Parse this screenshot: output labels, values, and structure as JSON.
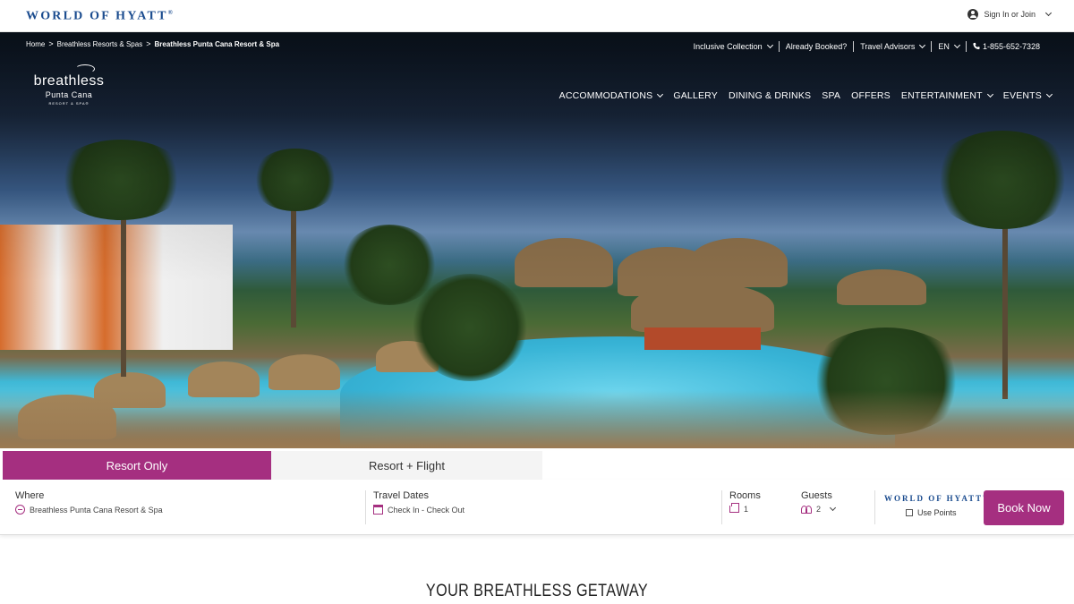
{
  "topbar": {
    "logo_text": "WORLD OF HYATT",
    "logo_mark": "®",
    "signin_label": "Sign In or Join"
  },
  "breadcrumb": {
    "items": [
      "Home",
      "Breathless Resorts & Spas",
      "Breathless Punta Cana Resort & Spa"
    ],
    "separator": ">"
  },
  "utility_nav": {
    "inclusive_collection": "Inclusive Collection",
    "already_booked": "Already Booked?",
    "travel_advisors": "Travel Advisors",
    "language": "EN",
    "phone": "1-855-652-7328"
  },
  "brand": {
    "line1": "breathless",
    "line2": "Punta Cana",
    "line3": "RESORT & SPA®"
  },
  "main_nav": {
    "items": [
      "ACCOMMODATIONS",
      "GALLERY",
      "DINING & DRINKS",
      "SPA",
      "OFFERS",
      "ENTERTAINMENT",
      "EVENTS"
    ]
  },
  "tabs": {
    "resort_only": "Resort Only",
    "resort_flight": "Resort + Flight"
  },
  "booking": {
    "where_label": "Where",
    "where_value": "Breathless Punta Cana Resort & Spa",
    "dates_label": "Travel Dates",
    "dates_value": "Check In - Check Out",
    "rooms_label": "Rooms",
    "rooms_value": "1",
    "guests_label": "Guests",
    "guests_value": "2",
    "hyatt_label": "WORLD OF HYATT",
    "hyatt_mark": "®",
    "use_points_label": "Use Points",
    "book_now": "Book Now"
  },
  "section": {
    "title": "YOUR BREATHLESS GETAWAY"
  },
  "colors": {
    "accent": "#a52f80",
    "hyatt_blue": "#1b4c8f"
  }
}
